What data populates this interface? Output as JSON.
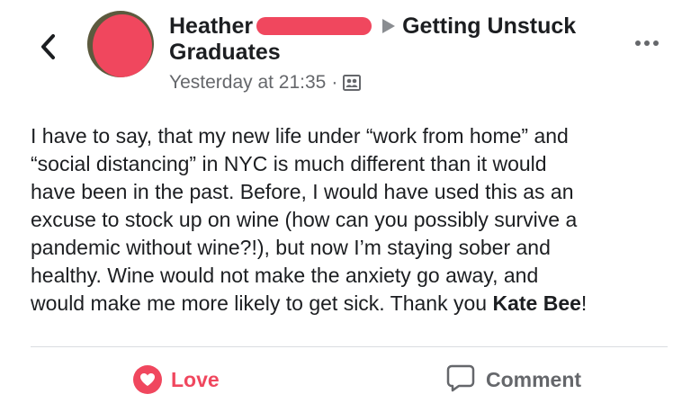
{
  "header": {
    "author_name": "Heather",
    "group_name_part1": "Getting Unstuck",
    "group_name_part2": "Graduates",
    "timestamp": "Yesterday at 21:35",
    "separator": "·",
    "audience_icon": "group-audience-icon",
    "back_icon": "chevron-left-icon",
    "more_icon": "more-horizontal-icon"
  },
  "post": {
    "lines": [
      "I have to say, that my new life under “work from home” and",
      "“social distancing” in NYC is much different than it would",
      "have been in the past. Before, I would have used this as an",
      "excuse to stock up on wine (how can you possibly survive a",
      "pandemic without wine?!), but now I’m staying sober and",
      "healthy. Wine would not make the anxiety go away, and"
    ],
    "last_line_text": "would make me more likely to get sick. Thank you ",
    "mention": "Kate Bee",
    "last_line_end": "!"
  },
  "actions": {
    "love_label": "Love",
    "comment_label": "Comment",
    "love_icon": "heart-icon",
    "comment_icon": "comment-bubble-icon"
  },
  "colors": {
    "love": "#f0475e",
    "text": "#1c1e21",
    "muted": "#65676b",
    "divider": "#dadde1"
  }
}
